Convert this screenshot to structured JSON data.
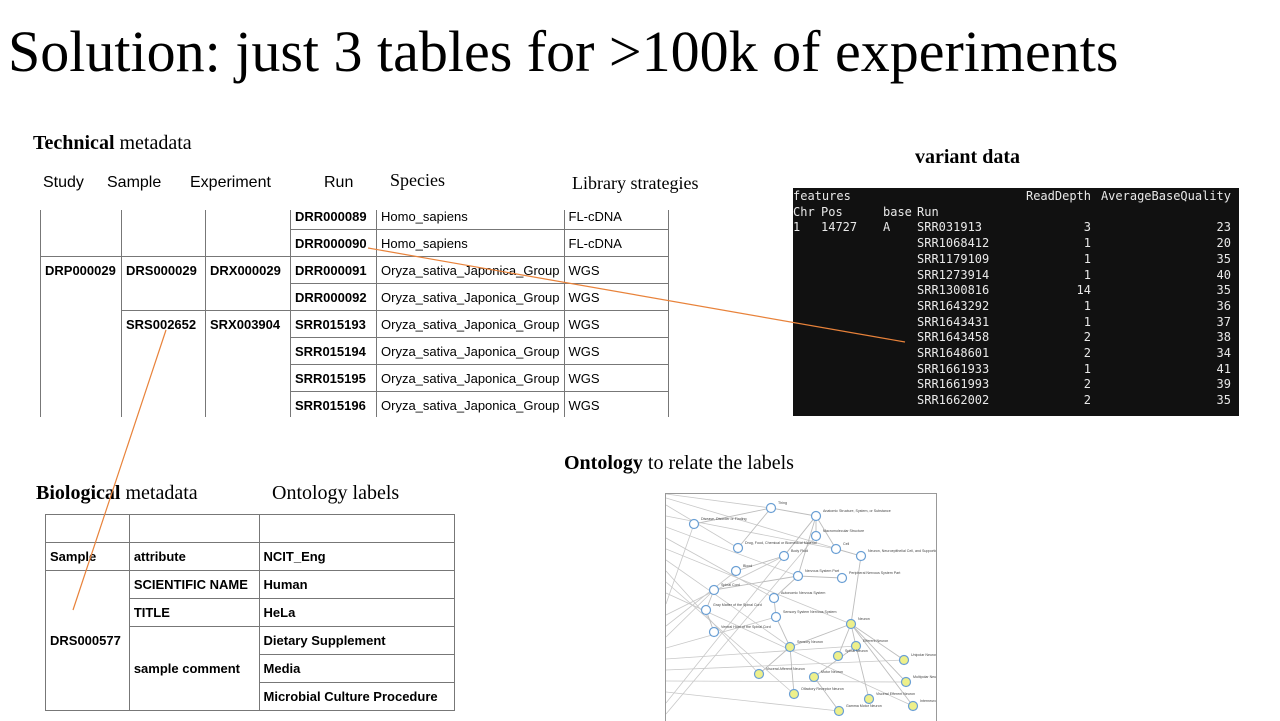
{
  "title": "Solution: just 3 tables for >100k  of experiments",
  "technical": {
    "heading_bold": "Technical",
    "heading_rest": " metadata",
    "columns": [
      "Study",
      "Sample",
      "Experiment",
      "Run",
      "Species",
      "Library strategies"
    ],
    "rows": [
      [
        "",
        "",
        "",
        "DRR000089",
        "Homo_sapiens",
        "FL-cDNA"
      ],
      [
        "",
        "",
        "",
        "DRR000090",
        "Homo_sapiens",
        "FL-cDNA"
      ],
      [
        "DRP000029",
        "DRS000029",
        "DRX000029",
        "DRR000091",
        "Oryza_sativa_Japonica_Group",
        "WGS"
      ],
      [
        "",
        "",
        "",
        "DRR000092",
        "Oryza_sativa_Japonica_Group",
        "WGS"
      ],
      [
        "",
        "SRS002652",
        "SRX003904",
        "SRR015193",
        "Oryza_sativa_Japonica_Group",
        "WGS"
      ],
      [
        "",
        "",
        "",
        "SRR015194",
        "Oryza_sativa_Japonica_Group",
        "WGS"
      ],
      [
        "",
        "",
        "",
        "SRR015195",
        "Oryza_sativa_Japonica_Group",
        "WGS"
      ],
      [
        "",
        "",
        "",
        "SRR015196",
        "Oryza_sativa_Japonica_Group",
        "WGS"
      ]
    ]
  },
  "variant": {
    "heading": "variant data",
    "header1": [
      "features",
      "",
      "",
      "",
      "ReadDepth",
      "AverageBaseQuality"
    ],
    "header2": [
      "Chr",
      "Pos",
      "base",
      "Run",
      "",
      ""
    ],
    "rows": [
      [
        "1",
        "14727",
        "A",
        "SRR031913",
        "3",
        "23"
      ],
      [
        "",
        "",
        "",
        "SRR1068412",
        "1",
        "20"
      ],
      [
        "",
        "",
        "",
        "SRR1179109",
        "1",
        "35"
      ],
      [
        "",
        "",
        "",
        "SRR1273914",
        "1",
        "40"
      ],
      [
        "",
        "",
        "",
        "SRR1300816",
        "14",
        "35"
      ],
      [
        "",
        "",
        "",
        "SRR1643292",
        "1",
        "36"
      ],
      [
        "",
        "",
        "",
        "SRR1643431",
        "1",
        "37"
      ],
      [
        "",
        "",
        "",
        "SRR1643458",
        "2",
        "38"
      ],
      [
        "",
        "",
        "",
        "SRR1648601",
        "2",
        "34"
      ],
      [
        "",
        "",
        "",
        "SRR1661933",
        "1",
        "41"
      ],
      [
        "",
        "",
        "",
        "SRR1661993",
        "2",
        "39"
      ],
      [
        "",
        "",
        "",
        "SRR1662002",
        "2",
        "35"
      ]
    ]
  },
  "biological": {
    "heading_bold": "Biological",
    "heading_rest": " metadata",
    "labels_heading": "Ontology labels",
    "header": [
      "Sample",
      "attribute",
      "NCIT_Eng"
    ],
    "sample": "DRS000577",
    "rows": [
      {
        "attribute": "SCIENTIFIC NAME",
        "label": "Human"
      },
      {
        "attribute": "TITLE",
        "label": "HeLa"
      },
      {
        "attribute": "sample comment",
        "labels": [
          "Dietary Supplement",
          "Media",
          "Microbial Culture Procedure"
        ]
      }
    ]
  },
  "ontology": {
    "heading_bold": "Ontology",
    "heading_rest": " to relate the labels",
    "nodes": [
      {
        "label": "Thing",
        "fill": "#ffffff"
      },
      {
        "label": "Anatomic Structure, System, or Substance",
        "fill": "#ffffff"
      },
      {
        "label": "Disease, Disorder or Finding",
        "fill": "#ffffff"
      },
      {
        "label": "Drug, Food, Chemical or Biomedical Material",
        "fill": "#ffffff"
      },
      {
        "label": "Macromolecular Structure",
        "fill": "#ffffff"
      },
      {
        "label": "Body Fluid",
        "fill": "#ffffff"
      },
      {
        "label": "Cell",
        "fill": "#ffffff"
      },
      {
        "label": "Neuron, Neuroepithelial Cell, and Supporting Cell of the Nervous System",
        "fill": "#ffffff"
      },
      {
        "label": "Blood",
        "fill": "#ffffff"
      },
      {
        "label": "Nervous System Part",
        "fill": "#ffffff"
      },
      {
        "label": "Peripheral Nervous System Part",
        "fill": "#ffffff"
      },
      {
        "label": "Spinal Cord",
        "fill": "#ffffff"
      },
      {
        "label": "Autonomic Nervous System",
        "fill": "#ffffff"
      },
      {
        "label": "Gray Matter of the Spinal Cord",
        "fill": "#ffffff"
      },
      {
        "label": "Sensory System Nervous System",
        "fill": "#ffffff"
      },
      {
        "label": "Neuron",
        "fill": "#eef08a"
      },
      {
        "label": "Ventral Horn of the Spinal Cord",
        "fill": "#ffffff"
      },
      {
        "label": "Efferent Neuron",
        "fill": "#eef08a"
      },
      {
        "label": "Sensory Neuron",
        "fill": "#eef08a"
      },
      {
        "label": "Spinal Neuron",
        "fill": "#eef08a"
      },
      {
        "label": "Unipolar Neuron",
        "fill": "#eef08a"
      },
      {
        "label": "Visceral Afferent Neuron",
        "fill": "#eef08a"
      },
      {
        "label": "Motor Neuron",
        "fill": "#eef08a"
      },
      {
        "label": "Multipolar Neuron",
        "fill": "#eef08a"
      },
      {
        "label": "Olfactory Receptor Neuron",
        "fill": "#eef08a"
      },
      {
        "label": "Visceral Efferent Neuron",
        "fill": "#eef08a"
      },
      {
        "label": "Gamma Motor Neuron",
        "fill": "#eef08a"
      },
      {
        "label": "Interneuron",
        "fill": "#eef08a"
      }
    ]
  },
  "colors": {
    "connector": "#e8823a",
    "terminal_bg": "#111111"
  }
}
